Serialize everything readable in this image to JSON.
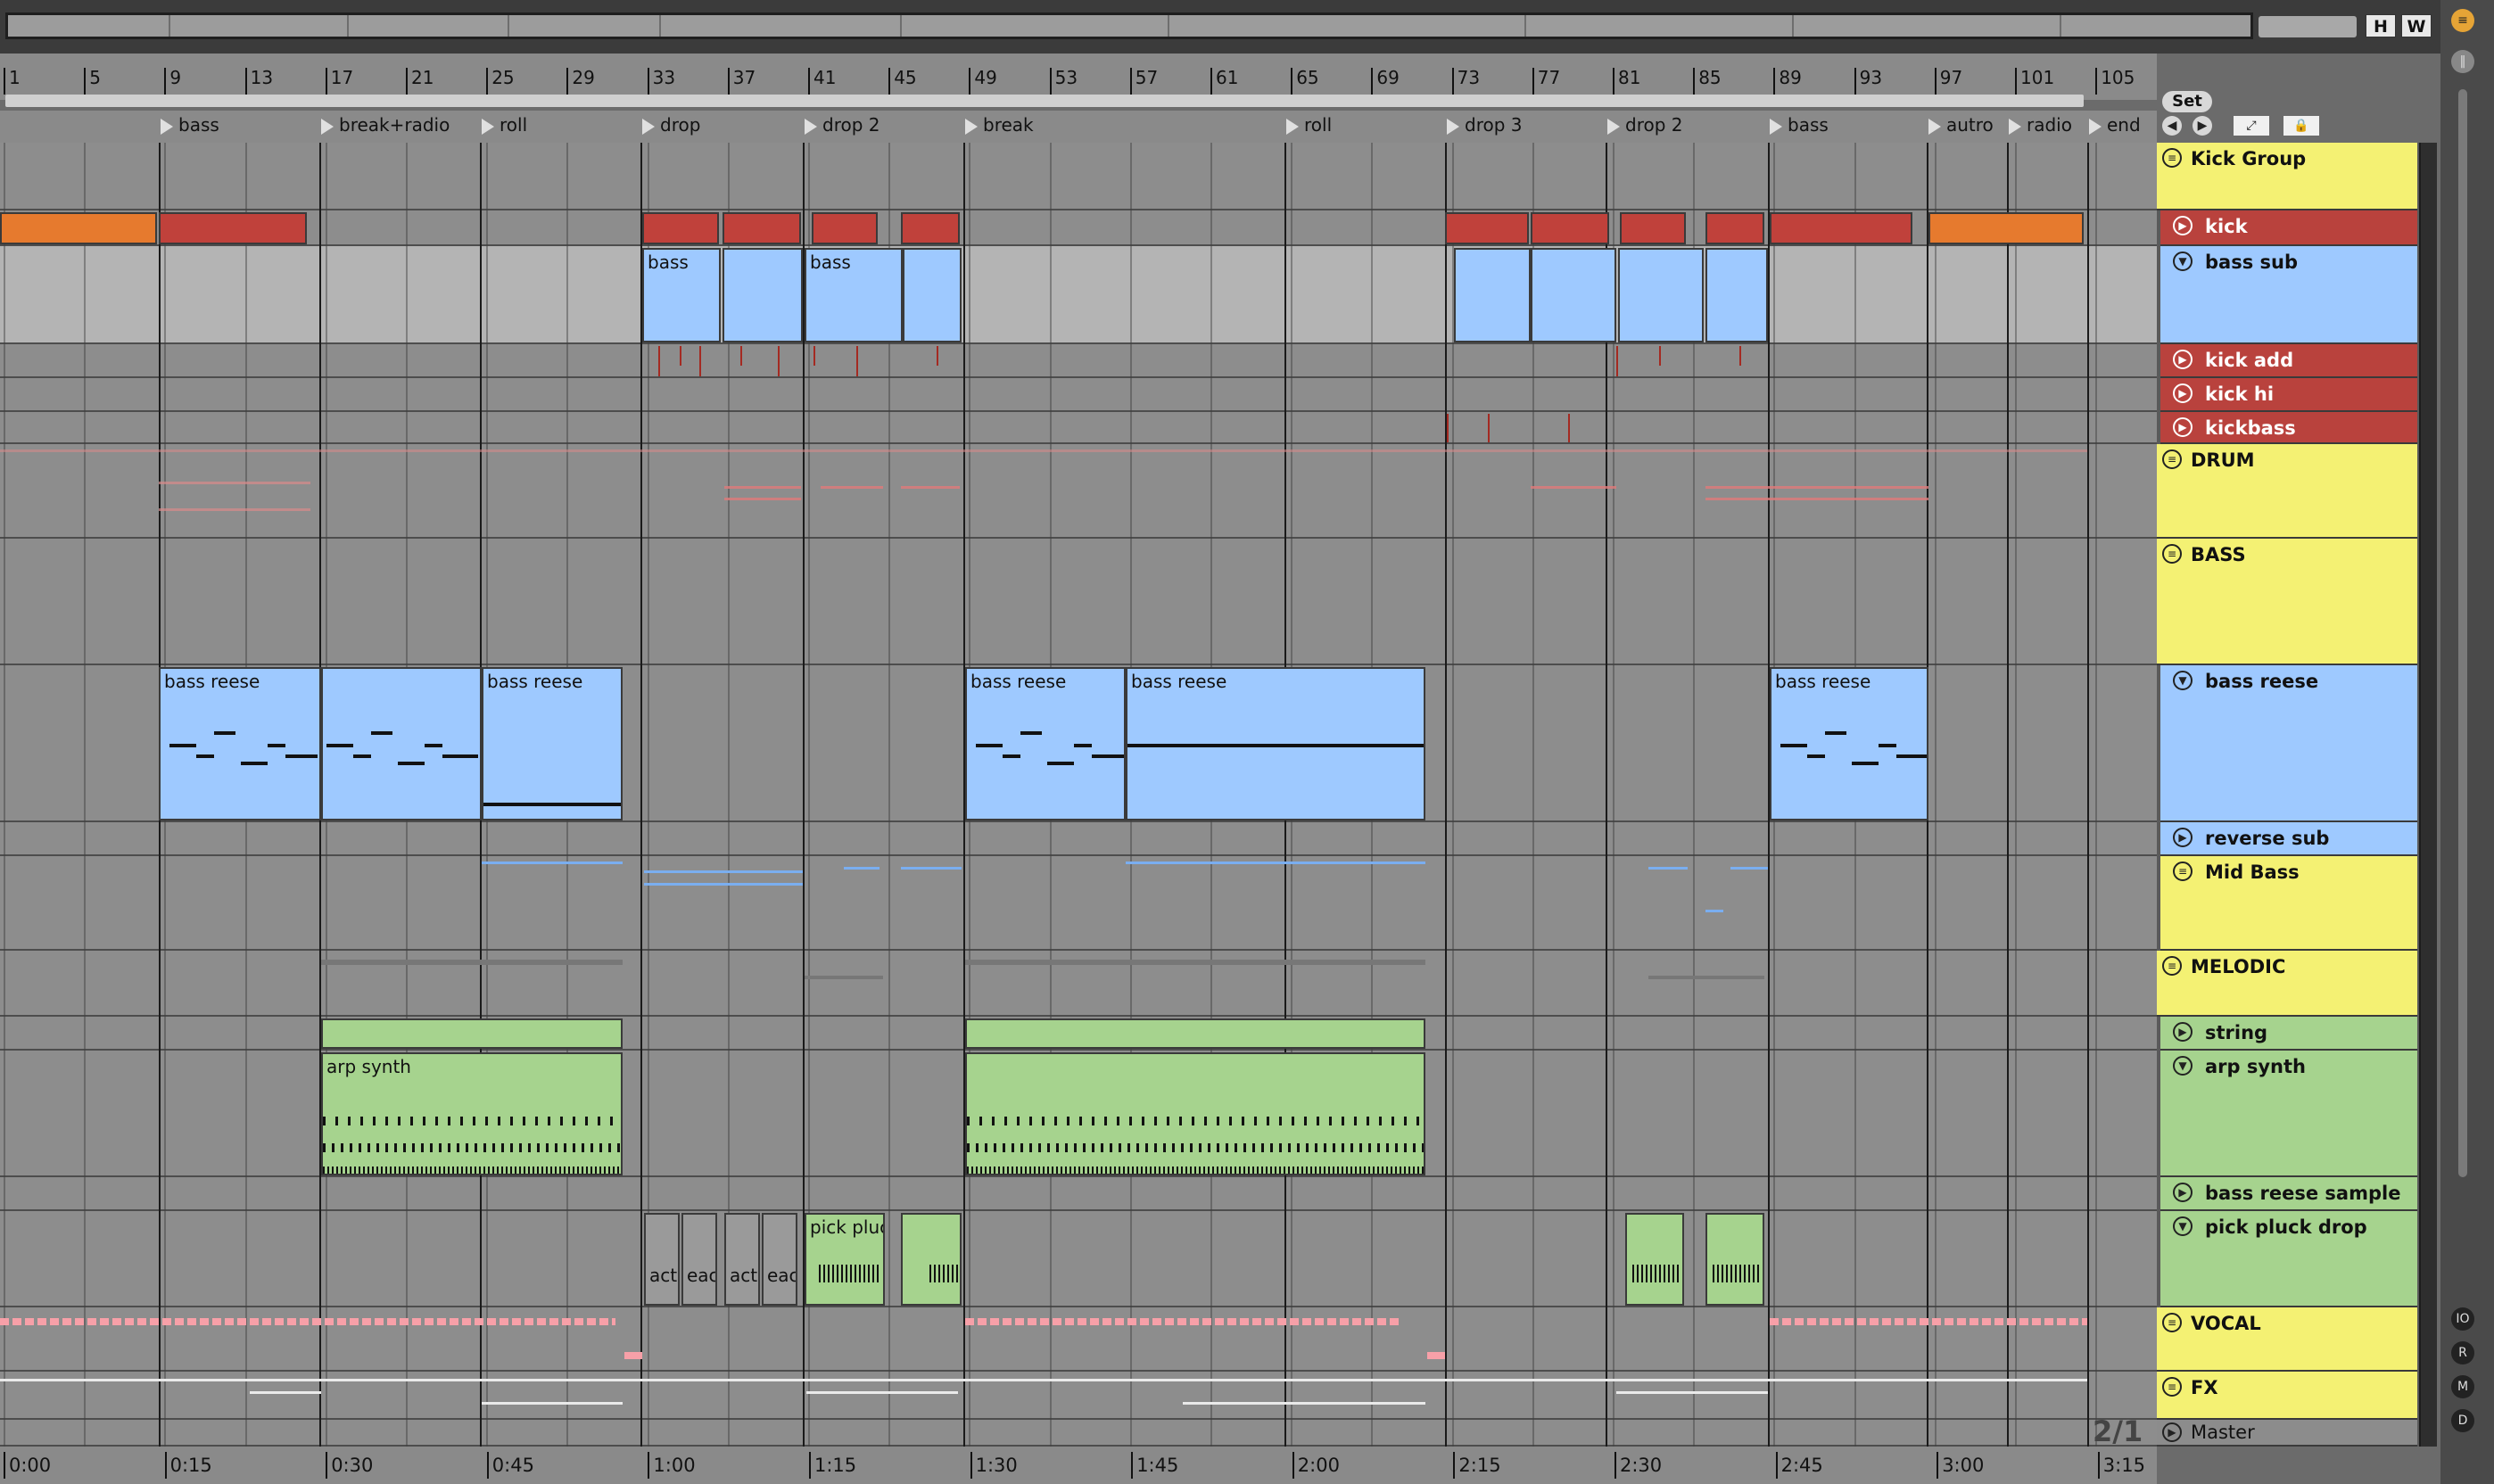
{
  "overview": {
    "h_label": "H",
    "w_label": "W"
  },
  "ruler": {
    "bars": [
      "1",
      "5",
      "9",
      "13",
      "17",
      "21",
      "25",
      "29",
      "33",
      "37",
      "41",
      "45",
      "49",
      "53",
      "57",
      "61",
      "65",
      "69",
      "73",
      "77",
      "81",
      "85",
      "89",
      "93",
      "97",
      "101",
      "105"
    ]
  },
  "locators": [
    "bass",
    "break+radio",
    "roll",
    "drop",
    "drop 2",
    "break",
    "roll",
    "drop 3",
    "drop 2",
    "bass",
    "autro",
    "radio",
    "end"
  ],
  "controls": {
    "set_label": "Set"
  },
  "clips": {
    "bass": "bass",
    "bass_reese": "bass reese",
    "arp_synth": "arp synth",
    "pick_pluck": "pick pluc",
    "react_a": "act",
    "react_b": "eact"
  },
  "tracks": {
    "kick_group": "Kick Group",
    "kick": "kick",
    "bass_sub": "bass sub",
    "kick_add": "kick add",
    "kick_hi": "kick hi",
    "kickbass": "kickbass",
    "drum": "DRUM",
    "bass": "BASS",
    "bass_reese": "bass reese",
    "reverse_sub": "reverse sub",
    "mid_bass": "Mid Bass",
    "melodic": "MELODIC",
    "string": "string",
    "arp_synth": "arp synth",
    "bass_reese_sample": "bass reese sample",
    "pick_pluck_drop": "pick pluck drop",
    "vocal": "VOCAL",
    "fx": "FX",
    "master": "Master"
  },
  "status": {
    "grid_zoom": "2/1"
  },
  "right_strip": [
    "IO",
    "R",
    "M",
    "D"
  ],
  "timebar": [
    "0:00",
    "0:15",
    "0:30",
    "0:45",
    "1:00",
    "1:15",
    "1:30",
    "1:45",
    "2:00",
    "2:15",
    "2:30",
    "2:45",
    "3:00",
    "3:15"
  ],
  "colors": {
    "orange": "#e67a2e",
    "red": "#c0413b",
    "blue": "#9ec9ff",
    "green": "#a6d38e",
    "yellow": "#f4f173",
    "pink": "#f7a0a8",
    "lightgray": "#b4b4b4"
  }
}
